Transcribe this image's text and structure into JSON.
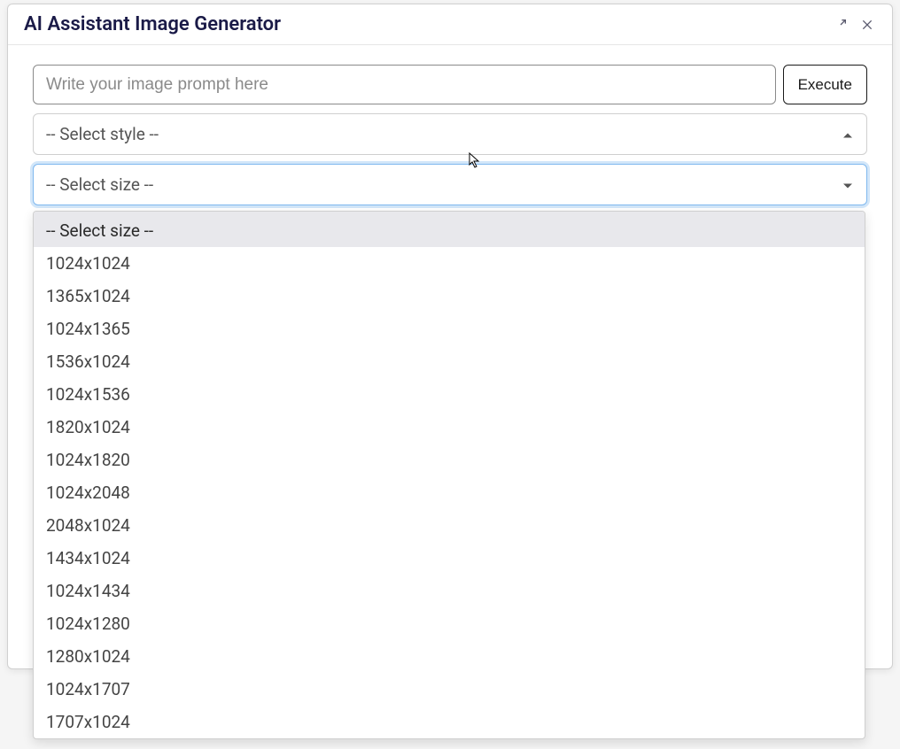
{
  "dialog": {
    "title": "AI Assistant Image Generator"
  },
  "prompt": {
    "placeholder": "Write your image prompt here",
    "value": ""
  },
  "buttons": {
    "execute": "Execute"
  },
  "style_select": {
    "placeholder": "-- Select style --",
    "open": false
  },
  "size_select": {
    "placeholder": "-- Select size --",
    "open": true,
    "selected_index": 0,
    "options": [
      "-- Select size --",
      "1024x1024",
      "1365x1024",
      "1024x1365",
      "1536x1024",
      "1024x1536",
      "1820x1024",
      "1024x1820",
      "1024x2048",
      "2048x1024",
      "1434x1024",
      "1024x1434",
      "1024x1280",
      "1280x1024",
      "1024x1707",
      "1707x1024"
    ]
  }
}
